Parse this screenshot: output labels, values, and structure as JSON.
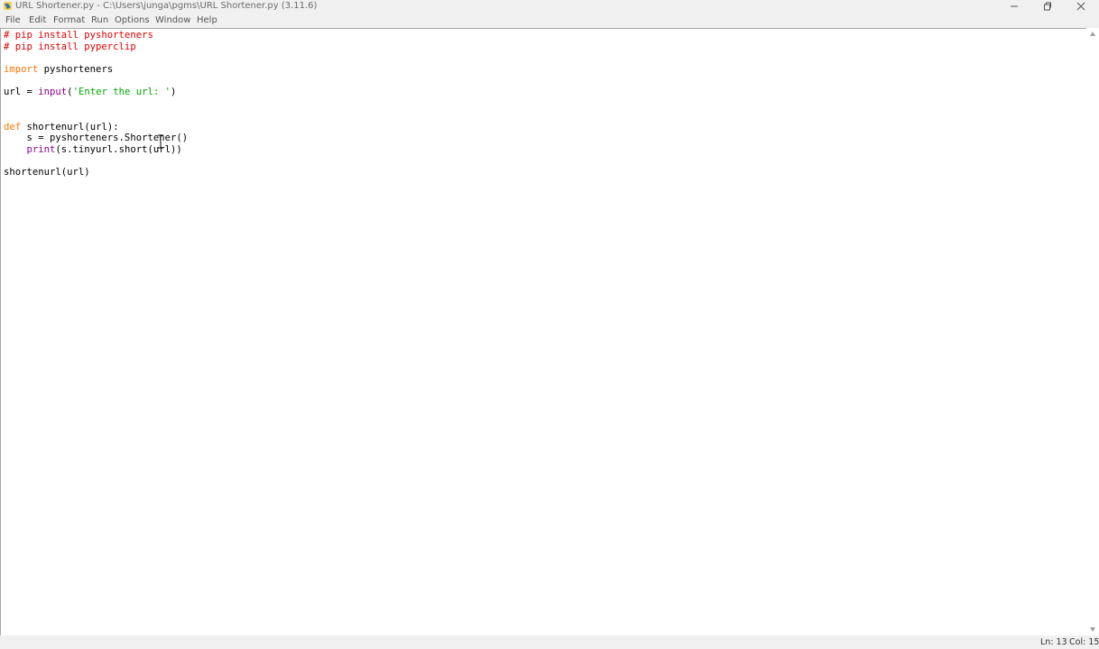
{
  "window": {
    "title": "URL Shortener.py - C:\\Users\\junga\\pgms\\URL Shortener.py (3.11.6)",
    "app_icon": "python-idle-icon",
    "controls": [
      "minimize-icon",
      "maximize-icon",
      "close-icon"
    ]
  },
  "menubar": {
    "items": [
      {
        "label": "File"
      },
      {
        "label": "Edit"
      },
      {
        "label": "Format"
      },
      {
        "label": "Run"
      },
      {
        "label": "Options"
      },
      {
        "label": "Window"
      },
      {
        "label": "Help"
      }
    ]
  },
  "editor": {
    "lines": [
      [
        {
          "t": "# pip install pyshorteners",
          "c": "comment"
        }
      ],
      [
        {
          "t": "# pip install pyperclip",
          "c": "comment"
        }
      ],
      [],
      [
        {
          "t": "import",
          "c": "keyword"
        },
        {
          "t": " pyshorteners",
          "c": "plain"
        }
      ],
      [],
      [
        {
          "t": "url = ",
          "c": "plain"
        },
        {
          "t": "input",
          "c": "builtin"
        },
        {
          "t": "(",
          "c": "plain"
        },
        {
          "t": "'Enter the url: '",
          "c": "string"
        },
        {
          "t": ")",
          "c": "plain"
        }
      ],
      [],
      [],
      [
        {
          "t": "def",
          "c": "keyword"
        },
        {
          "t": " ",
          "c": "plain"
        },
        {
          "t": "shortenurl",
          "c": "plain"
        },
        {
          "t": "(url):",
          "c": "plain"
        }
      ],
      [
        {
          "t": "    s = pyshorteners.Shortener()",
          "c": "plain"
        }
      ],
      [
        {
          "t": "    ",
          "c": "plain"
        },
        {
          "t": "print",
          "c": "builtin"
        },
        {
          "t": "(s.tinyurl.short(url))",
          "c": "plain"
        }
      ],
      [],
      [
        {
          "t": "shortenurl(url)",
          "c": "plain"
        }
      ]
    ]
  },
  "status": {
    "line": "Ln: 13",
    "col": "Col: 15"
  },
  "colors": {
    "comment": "#dd0000",
    "keyword": "#ff7700",
    "builtin": "#900090",
    "string": "#00aa00",
    "chrome": "#f0f0f0"
  }
}
